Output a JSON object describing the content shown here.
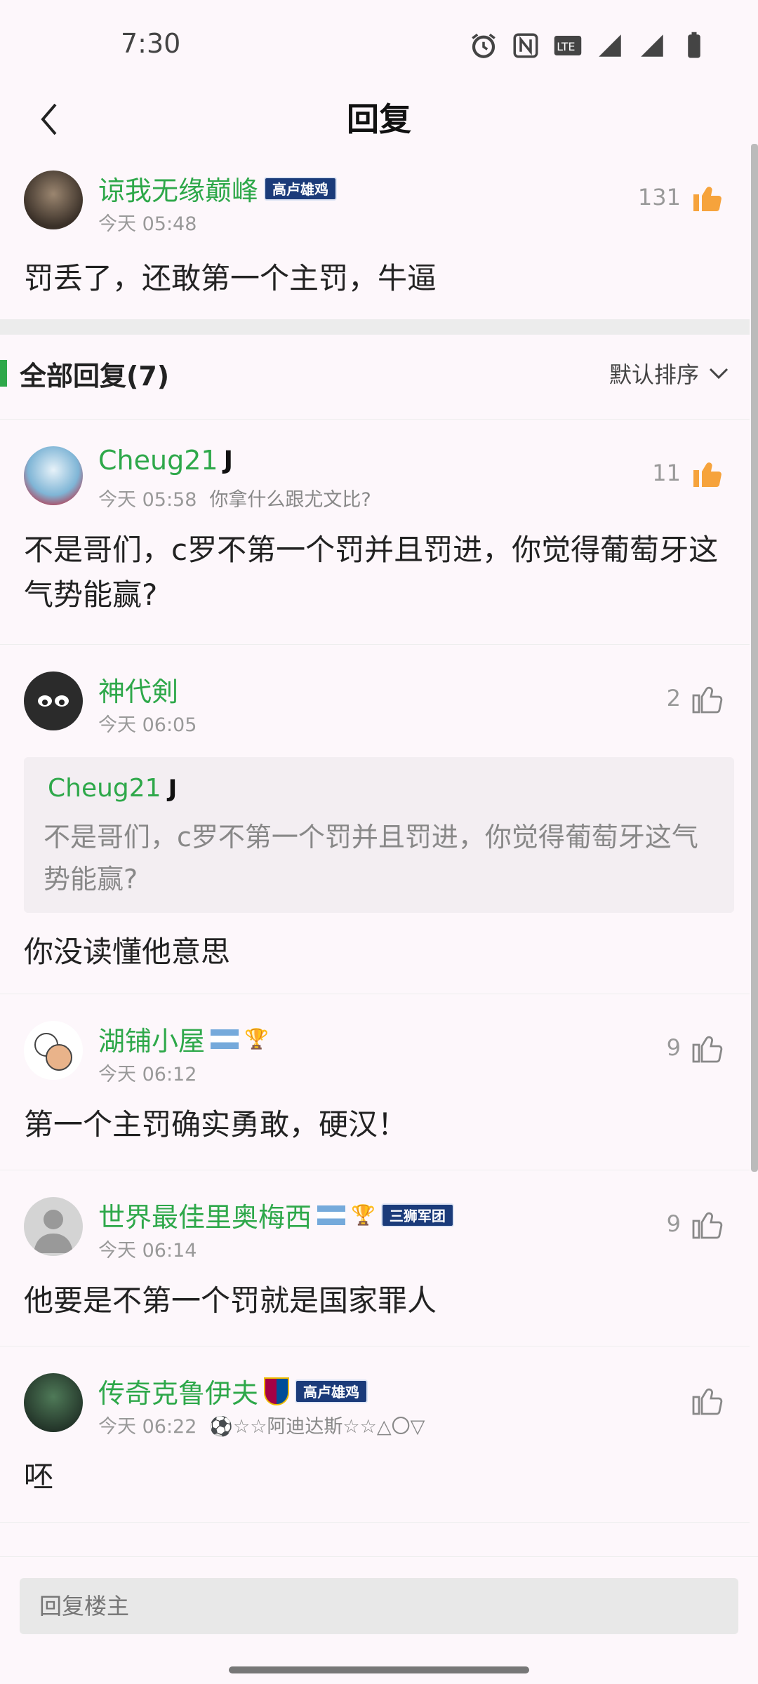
{
  "status": {
    "time": "7:30"
  },
  "header": {
    "title": "回复"
  },
  "main_comment": {
    "username": "谅我无缘巅峰",
    "badge": "高卢雄鸡",
    "time": "今天 05:48",
    "likes": "131",
    "content": "罚丢了，还敢第一个主罚，牛逼"
  },
  "replies_header": {
    "title": "全部回复(7)",
    "sort_label": "默认排序"
  },
  "replies": [
    {
      "username": "Cheug21",
      "time": "今天 05:58",
      "signature": "你拿什么跟尤文比?",
      "likes": "11",
      "content": "不是哥们，c罗不第一个罚并且罚进，你觉得葡萄牙这气势能赢?"
    },
    {
      "username": "神代剣",
      "time": "今天 06:05",
      "likes": "2",
      "quote_user": "Cheug21",
      "quote_text": "不是哥们，c罗不第一个罚并且罚进，你觉得葡萄牙这气势能赢?",
      "content": "你没读懂他意思"
    },
    {
      "username": "湖铺小屋",
      "time": "今天 06:12",
      "likes": "9",
      "content": "第一个主罚确实勇敢，硬汉！"
    },
    {
      "username": "世界最佳里奥梅西",
      "badge": "三狮军团",
      "time": "今天 06:14",
      "likes": "9",
      "content": "他要是不第一个罚就是国家罪人"
    },
    {
      "username": "传奇克鲁伊夫",
      "badge": "高卢雄鸡",
      "time": "今天 06:22",
      "signature": "⚽☆☆阿迪达斯☆☆△〇▽",
      "likes": "",
      "content": "呸"
    }
  ],
  "footer": {
    "reply_placeholder": "回复楼主"
  }
}
